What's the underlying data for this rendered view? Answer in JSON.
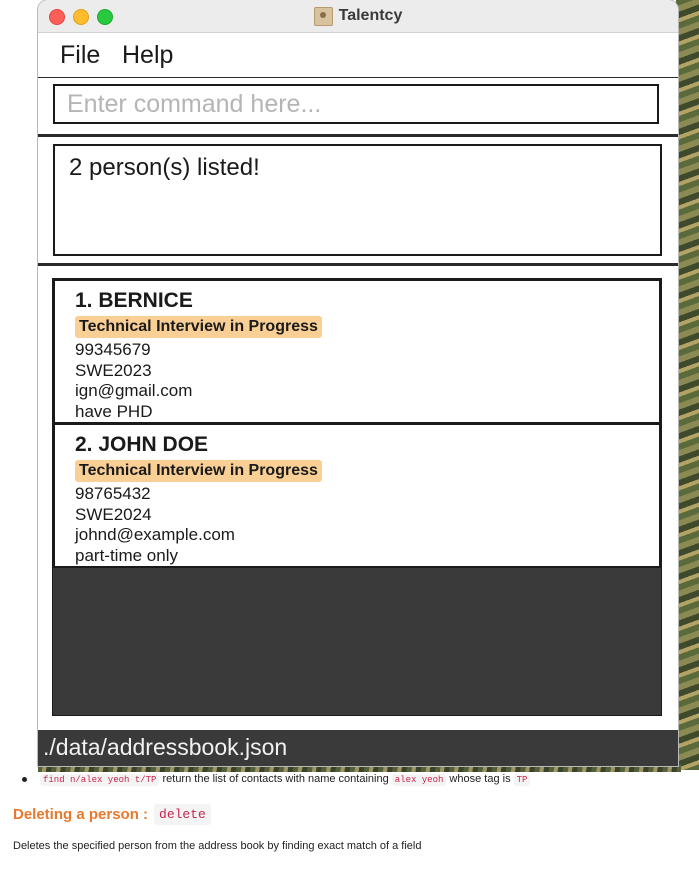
{
  "window": {
    "title": "Talentcy"
  },
  "menu": {
    "items": [
      "File",
      "Help"
    ]
  },
  "command": {
    "placeholder": "Enter command here..."
  },
  "result": {
    "message": "2 person(s) listed!"
  },
  "persons": [
    {
      "index_name": "1. BERNICE",
      "tag": "Technical Interview in Progress",
      "phone": "99345679",
      "role": "SWE2023",
      "email": "ign@gmail.com",
      "note": "have PHD"
    },
    {
      "index_name": "2. JOHN DOE",
      "tag": "Technical Interview in Progress",
      "phone": "98765432",
      "role": "SWE2024",
      "email": "johnd@example.com",
      "note": "part-time only"
    }
  ],
  "status": {
    "path": "./data/addressbook.json"
  },
  "doc": {
    "bullet": {
      "code1": "find n/alex yeoh t/TP",
      "text1": " return the list of contacts with name containing ",
      "code2": "alex yeoh",
      "text2": " whose tag is ",
      "code3": "TP"
    },
    "heading": {
      "text": "Deleting a person :",
      "code": "delete"
    },
    "paragraph": "Deletes the specified person from the address book by finding exact match of a field"
  },
  "colors": {
    "tag_bg": "#f9cf96",
    "heading": "#e8792c",
    "code": "#c7254e",
    "list_bg": "#3a3a3a"
  }
}
